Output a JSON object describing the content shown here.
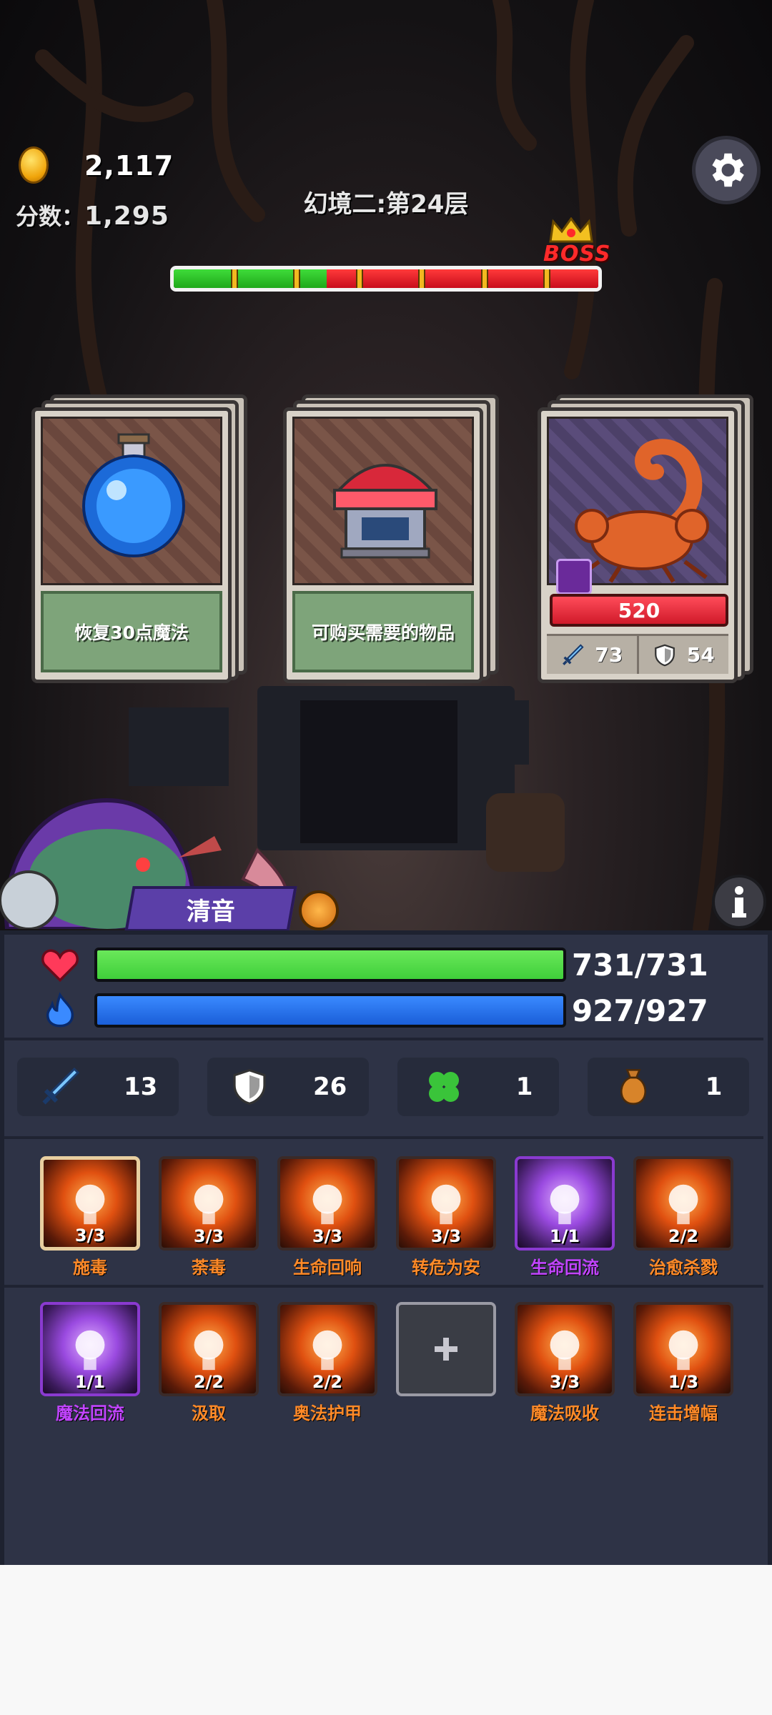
{
  "header": {
    "coins": "2,117",
    "score_label": "分数：",
    "score_value": "1,295",
    "level_title": "幻境二:第24层",
    "boss_label": "BOSS",
    "progress_fraction": 0.36
  },
  "cards": [
    {
      "desc": "恢复30点魔法",
      "icon": "mana-potion-icon"
    },
    {
      "desc": "可购买需要的物品",
      "icon": "shop-icon"
    },
    {
      "icon": "scorpion-enemy",
      "hp": "520",
      "attack": "73",
      "defense": "54"
    }
  ],
  "hero": {
    "name": "清音",
    "hp": "731/731",
    "mp": "927/927",
    "hp_fraction": 1.0,
    "mp_fraction": 1.0
  },
  "stats": [
    {
      "icon": "sword-icon",
      "value": "13"
    },
    {
      "icon": "shield-icon",
      "value": "26"
    },
    {
      "icon": "clover-icon",
      "value": "1"
    },
    {
      "icon": "money-bag-icon",
      "value": "1"
    }
  ],
  "skills_row1": [
    {
      "name": "施毒",
      "count": "3/3",
      "color": "orange"
    },
    {
      "name": "荼毒",
      "count": "3/3",
      "color": "orange"
    },
    {
      "name": "生命回响",
      "count": "3/3",
      "color": "orange"
    },
    {
      "name": "转危为安",
      "count": "3/3",
      "color": "orange"
    },
    {
      "name": "生命回流",
      "count": "1/1",
      "color": "purple"
    },
    {
      "name": "治愈杀戮",
      "count": "2/2",
      "color": "orange"
    }
  ],
  "skills_row2": [
    {
      "name": "魔法回流",
      "count": "1/1",
      "color": "purple"
    },
    {
      "name": "汲取",
      "count": "2/2",
      "color": "orange"
    },
    {
      "name": "奥法护甲",
      "count": "2/2",
      "color": "orange"
    },
    {
      "name": "",
      "count": "",
      "color": "empty"
    },
    {
      "name": "魔法吸收",
      "count": "3/3",
      "color": "orange"
    },
    {
      "name": "连击增幅",
      "count": "1/3",
      "color": "orange"
    }
  ],
  "colors": {
    "hp_bar": "#3fcf3a",
    "mp_bar": "#1a5ed8",
    "skill_orange": "#ff8a28",
    "skill_purple": "#c244ff"
  }
}
